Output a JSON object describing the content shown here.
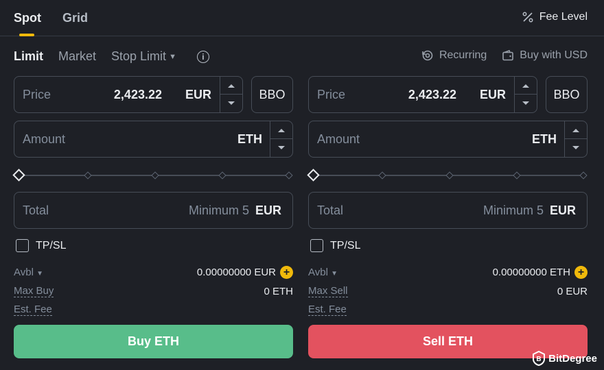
{
  "tabs": {
    "spot": "Spot",
    "grid": "Grid"
  },
  "fee_level": {
    "icon": "percent-icon",
    "label": "Fee Level"
  },
  "order_types": {
    "limit": "Limit",
    "market": "Market",
    "stop_limit": "Stop Limit",
    "info_icon": "i"
  },
  "options": {
    "recurring": "Recurring",
    "buy_with_usd": "Buy with USD"
  },
  "colors": {
    "accent": "#f0b90b",
    "buy": "#58bd8a",
    "sell": "#e3525f",
    "background": "#1e2026"
  },
  "buy": {
    "price_label": "Price",
    "price_value": "2,423.22",
    "price_unit": "EUR",
    "bbo": "BBO",
    "amount_label": "Amount",
    "amount_unit": "ETH",
    "slider_percent": 0,
    "total_label": "Total",
    "total_placeholder": "Minimum 5",
    "total_unit": "EUR",
    "tpsl": "TP/SL",
    "avbl_label": "Avbl",
    "avbl_value": "0.00000000 EUR",
    "max_label": "Max Buy",
    "max_value": "0 ETH",
    "fee_label": "Est. Fee",
    "button": "Buy ETH"
  },
  "sell": {
    "price_label": "Price",
    "price_value": "2,423.22",
    "price_unit": "EUR",
    "bbo": "BBO",
    "amount_label": "Amount",
    "amount_unit": "ETH",
    "slider_percent": 0,
    "total_label": "Total",
    "total_placeholder": "Minimum 5",
    "total_unit": "EUR",
    "tpsl": "TP/SL",
    "avbl_label": "Avbl",
    "avbl_value": "0.00000000 ETH",
    "max_label": "Max Sell",
    "max_value": "0 EUR",
    "fee_label": "Est. Fee",
    "button": "Sell ETH"
  },
  "watermark": "BitDegree"
}
